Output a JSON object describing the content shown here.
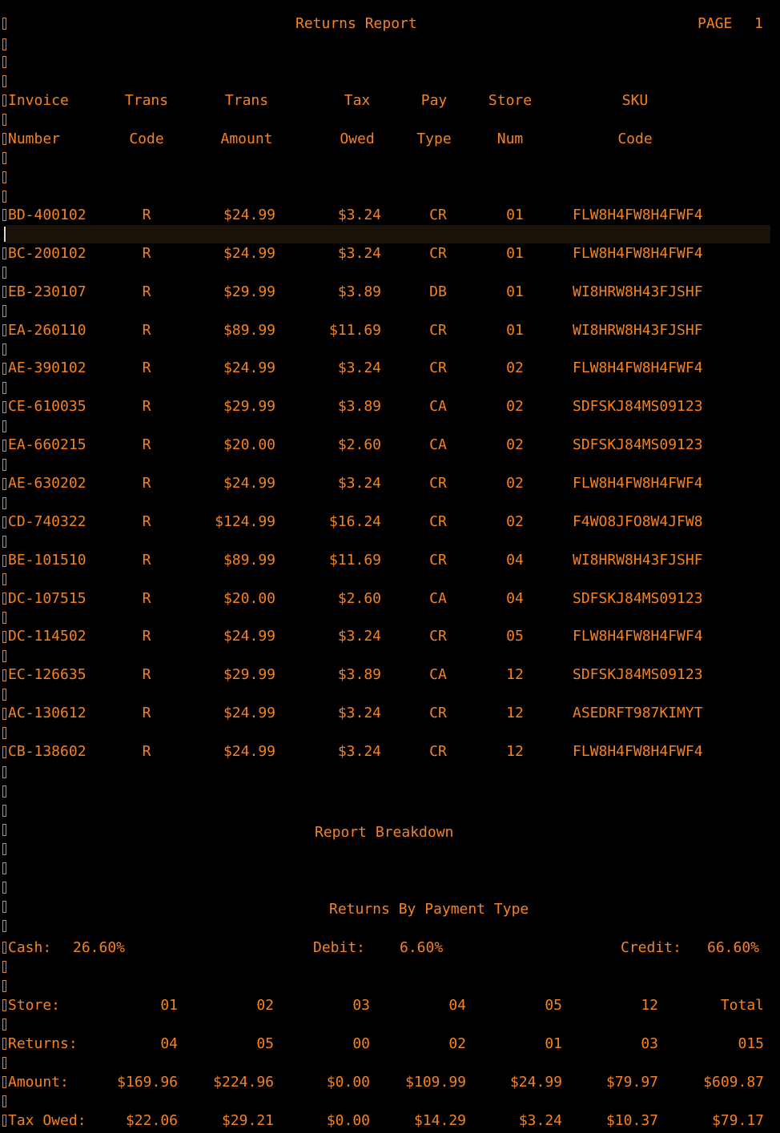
{
  "report": {
    "title": "Returns Report",
    "page_label": "PAGE",
    "page_num": "1"
  },
  "headers": {
    "row1": [
      "Invoice",
      "Trans",
      "Trans",
      "Tax",
      "Pay",
      "Store",
      "SKU"
    ],
    "row2": [
      "Number",
      "Code",
      "Amount",
      "Owed",
      "Type",
      "Num",
      "Code"
    ]
  },
  "rows": [
    [
      "BD-400102",
      "R",
      "$24.99",
      "$3.24",
      "CR",
      "01",
      "FLW8H4FW8H4FWF4"
    ],
    [
      "BC-200102",
      "R",
      "$24.99",
      "$3.24",
      "CR",
      "01",
      "FLW8H4FW8H4FWF4"
    ],
    [
      "EB-230107",
      "R",
      "$29.99",
      "$3.89",
      "DB",
      "01",
      "WI8HRW8H43FJSHF"
    ],
    [
      "EA-260110",
      "R",
      "$89.99",
      "$11.69",
      "CR",
      "01",
      "WI8HRW8H43FJSHF"
    ],
    [
      "AE-390102",
      "R",
      "$24.99",
      "$3.24",
      "CR",
      "02",
      "FLW8H4FW8H4FWF4"
    ],
    [
      "CE-610035",
      "R",
      "$29.99",
      "$3.89",
      "CA",
      "02",
      "SDFSKJ84MS09123"
    ],
    [
      "EA-660215",
      "R",
      "$20.00",
      "$2.60",
      "CA",
      "02",
      "SDFSKJ84MS09123"
    ],
    [
      "AE-630202",
      "R",
      "$24.99",
      "$3.24",
      "CR",
      "02",
      "FLW8H4FW8H4FWF4"
    ],
    [
      "CD-740322",
      "R",
      "$124.99",
      "$16.24",
      "CR",
      "02",
      "F4WO8JFO8W4JFW8"
    ],
    [
      "BE-101510",
      "R",
      "$89.99",
      "$11.69",
      "CR",
      "04",
      "WI8HRW8H43FJSHF"
    ],
    [
      "DC-107515",
      "R",
      "$20.00",
      "$2.60",
      "CA",
      "04",
      "SDFSKJ84MS09123"
    ],
    [
      "DC-114502",
      "R",
      "$24.99",
      "$3.24",
      "CR",
      "05",
      "FLW8H4FW8H4FWF4"
    ],
    [
      "EC-126635",
      "R",
      "$29.99",
      "$3.89",
      "CA",
      "12",
      "SDFSKJ84MS09123"
    ],
    [
      "AC-130612",
      "R",
      "$24.99",
      "$3.24",
      "CR",
      "12",
      "ASEDRFT987KIMYT"
    ],
    [
      "CB-138602",
      "R",
      "$24.99",
      "$3.24",
      "CR",
      "12",
      "FLW8H4FW8H4FWF4"
    ]
  ],
  "breakdown": {
    "title": "Report Breakdown",
    "payment_title": "Returns By Payment Type",
    "payment": {
      "cash_label": "Cash:",
      "cash_value": "26.60%",
      "debit_label": "Debit:",
      "debit_value": "6.60%",
      "credit_label": "Credit:",
      "credit_value": "66.60%"
    },
    "table": [
      {
        "label": "Store:",
        "values": [
          "01",
          "02",
          "03",
          "04",
          "05",
          "12",
          "Total"
        ]
      },
      {
        "label": "Returns:",
        "values": [
          "04",
          "05",
          "00",
          "02",
          "01",
          "03",
          "015"
        ]
      },
      {
        "label": "Amount:",
        "values": [
          "$169.96",
          "$224.96",
          "$0.00",
          "$109.99",
          "$24.99",
          "$79.97",
          "$609.87"
        ]
      },
      {
        "label": "Tax Owed:",
        "values": [
          "$22.06",
          "$29.21",
          "$0.00",
          "$14.29",
          "$3.24",
          "$10.37",
          "$79.17"
        ]
      }
    ]
  },
  "colors": {
    "text": "#f58220",
    "background": "#000000",
    "cursor_line": "#1a1209"
  }
}
